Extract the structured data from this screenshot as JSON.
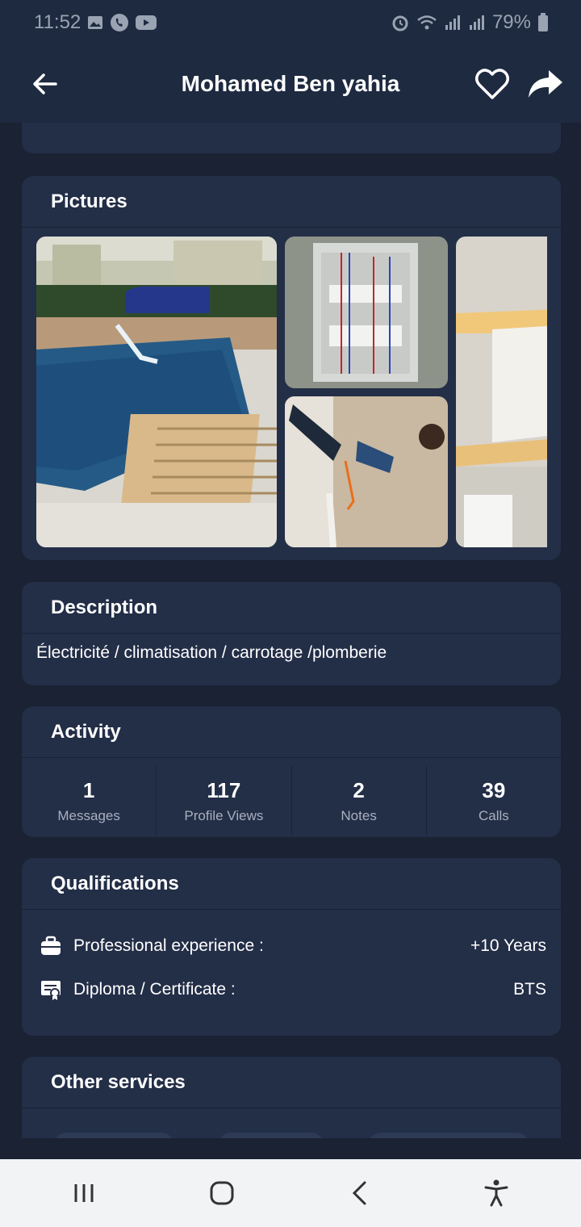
{
  "status_bar": {
    "time": "11:52",
    "battery": "79%",
    "icons_left": [
      "gallery-icon",
      "whatsapp-icon",
      "youtube-icon"
    ],
    "icons_right": [
      "alarm-icon",
      "wifi-icon",
      "signal-icon",
      "signal-icon",
      "battery-icon"
    ]
  },
  "header": {
    "title": "Mohamed Ben yahia",
    "back_icon": "arrow-left-icon",
    "favorite_icon": "heart-outline-icon",
    "share_icon": "share-arrow-icon"
  },
  "pictures": {
    "title": "Pictures",
    "images": [
      "pool photo",
      "electrical panel photo",
      "wall drilling photo",
      "ceiling lighting photo"
    ]
  },
  "description": {
    "title": "Description",
    "text": "Électricité / climatisation / carrotage /plomberie"
  },
  "activity": {
    "title": "Activity",
    "stats": [
      {
        "value": "1",
        "label": "Messages"
      },
      {
        "value": "117",
        "label": "Profile Views"
      },
      {
        "value": "2",
        "label": "Notes"
      },
      {
        "value": "39",
        "label": "Calls"
      }
    ]
  },
  "qualifications": {
    "title": "Qualifications",
    "rows": [
      {
        "icon": "briefcase-icon",
        "label": "Professional experience :",
        "value": "+10 Years"
      },
      {
        "icon": "certificate-icon",
        "label": "Diploma / Certificate :",
        "value": "BTS"
      }
    ]
  },
  "other_services": {
    "title": "Other services"
  },
  "nav": {
    "icons": [
      "recents-icon",
      "home-icon",
      "back-icon",
      "accessibility-icon"
    ]
  },
  "colors": {
    "background": "#1a2233",
    "card": "#232e47",
    "header": "#1e2a40",
    "nav_bar": "#f2f3f5"
  }
}
